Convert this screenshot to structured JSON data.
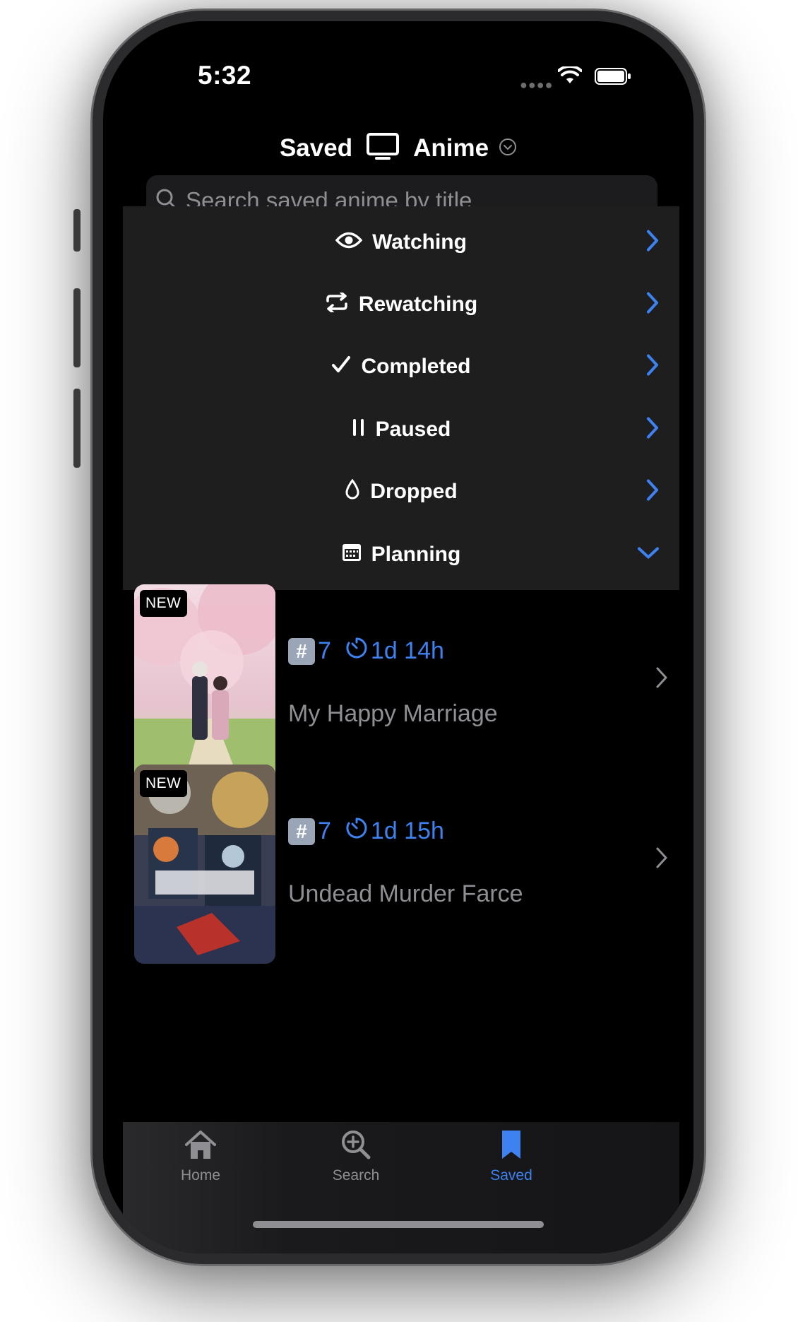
{
  "status_bar": {
    "time": "5:32"
  },
  "header": {
    "title_left": "Saved",
    "title_right": "Anime"
  },
  "search": {
    "placeholder": "Search saved anime by title"
  },
  "sections": [
    {
      "label": "Watching",
      "icon": "eye-icon",
      "state": "collapsed"
    },
    {
      "label": "Rewatching",
      "icon": "repeat-icon",
      "state": "collapsed"
    },
    {
      "label": "Completed",
      "icon": "checkmark-icon",
      "state": "collapsed"
    },
    {
      "label": "Paused",
      "icon": "pause-icon",
      "state": "collapsed"
    },
    {
      "label": "Dropped",
      "icon": "drop-icon",
      "state": "collapsed"
    },
    {
      "label": "Planning",
      "icon": "calendar-icon",
      "state": "expanded"
    }
  ],
  "planning_items": [
    {
      "badge": "NEW",
      "hash": "#",
      "episode": "7",
      "countdown": "1d 14h",
      "title": "My Happy Marriage"
    },
    {
      "badge": "NEW",
      "hash": "#",
      "episode": "7",
      "countdown": "1d 15h",
      "title": "Undead Murder Farce"
    }
  ],
  "tabbar": {
    "tabs": [
      {
        "label": "Home",
        "icon": "house-icon",
        "active": false
      },
      {
        "label": "Search",
        "icon": "magnifier-plus-icon",
        "active": false
      },
      {
        "label": "Saved",
        "icon": "bookmark-icon",
        "active": true
      }
    ]
  },
  "colors": {
    "accent": "#3d82f0",
    "background": "#000000",
    "row": "#1e1e1f",
    "muted": "#8e8e93"
  }
}
